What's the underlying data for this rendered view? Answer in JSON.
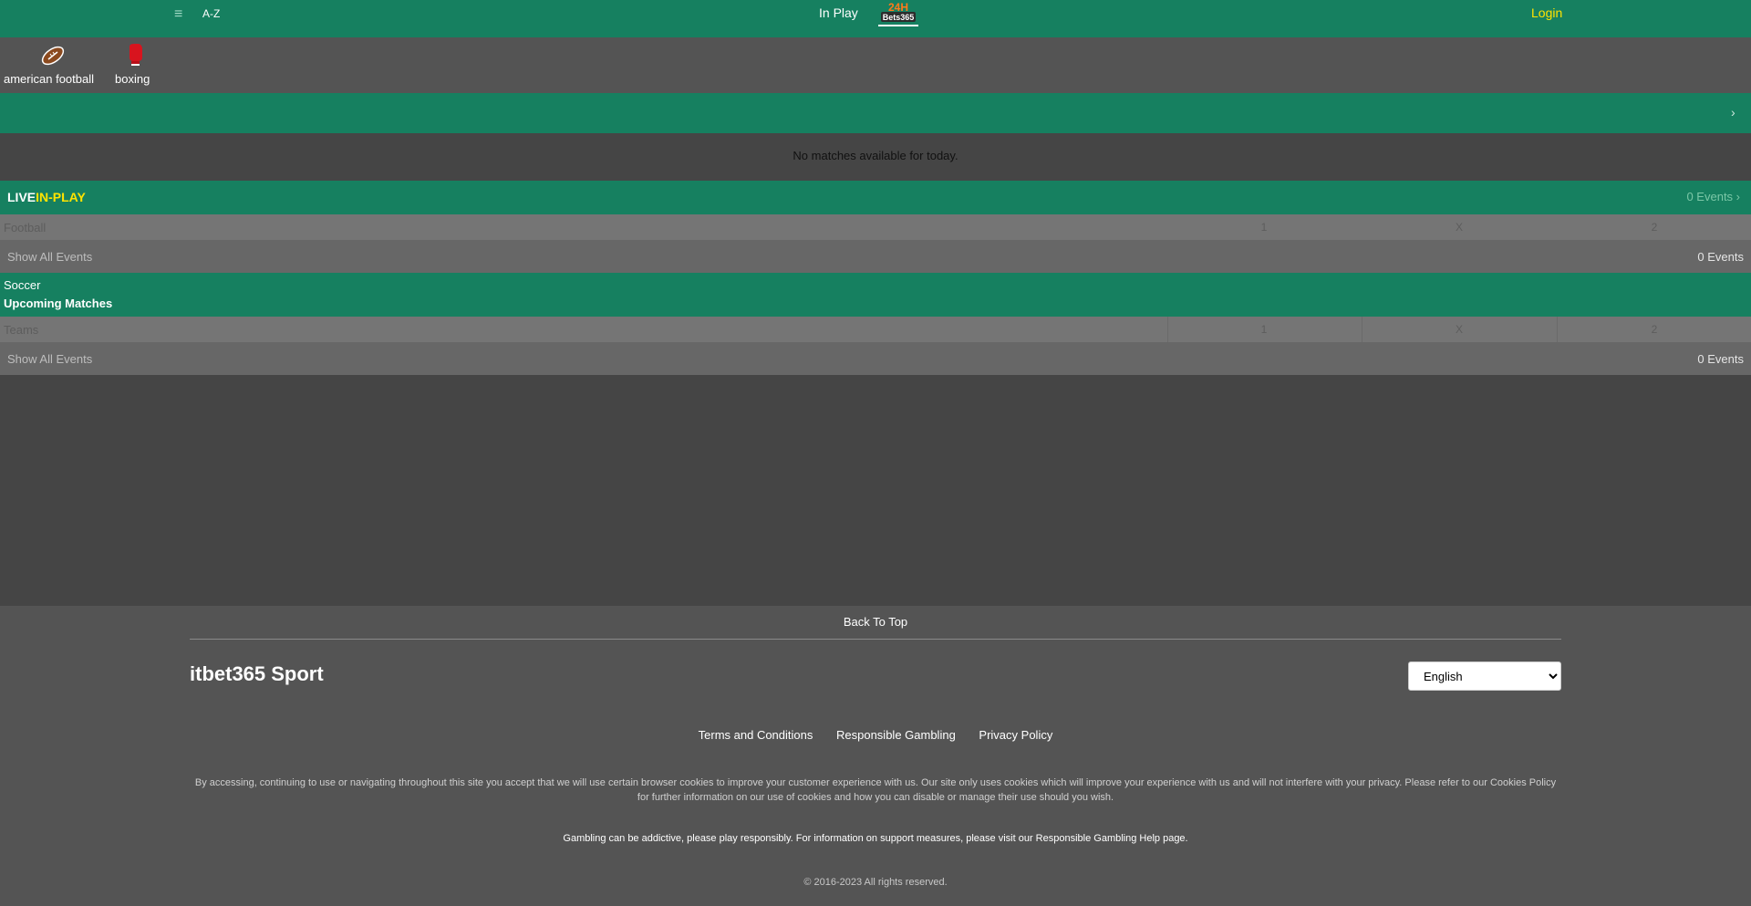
{
  "header": {
    "menu_icon": "hamburger-icon",
    "az_label": "A-Z",
    "inplay_label": "In Play",
    "logo_text_top": "24H",
    "logo_text_bottom": "Bets365",
    "login_label": "Login",
    "colors": {
      "bar": "#168060",
      "accent": "#ffe300"
    }
  },
  "sports": [
    {
      "label": "american football",
      "icon": "american-football-icon"
    },
    {
      "label": "boxing",
      "icon": "boxing-glove-icon"
    }
  ],
  "today": {
    "message": "No matches available for today."
  },
  "live": {
    "label_live": "LIVE",
    "label_inplay": "IN-PLAY",
    "events_count": "0 Events ›",
    "header": {
      "title": "Football",
      "col1": "1",
      "colx": "X",
      "col2": "2"
    },
    "show_all": "Show All Events",
    "show_count": "0 Events"
  },
  "upcoming": {
    "sport": "Soccer",
    "title": "Upcoming Matches",
    "header": {
      "title": "Teams",
      "col1": "1",
      "colx": "X",
      "col2": "2"
    },
    "show_all": "Show All Events",
    "show_count": "0 Events"
  },
  "footer": {
    "back_to_top": "Back To Top",
    "brand": "itbet365 Sport",
    "language": "English",
    "links": [
      "Terms and Conditions",
      "Responsible Gambling",
      "Privacy Policy"
    ],
    "disclaimer": "By accessing, continuing to use or navigating throughout this site you accept that we will use certain browser cookies to improve your customer experience with us. Our site only uses cookies which will improve your experience with us and will not interfere with your privacy. Please refer to our Cookies Policy for further information on our use of cookies and how you can disable or manage their use should you wish.",
    "gambling_note": "Gambling can be addictive, please play responsibly. For information on support measures, please visit our Responsible Gambling Help page.",
    "copyright": "© 2016-2023 All rights reserved."
  }
}
